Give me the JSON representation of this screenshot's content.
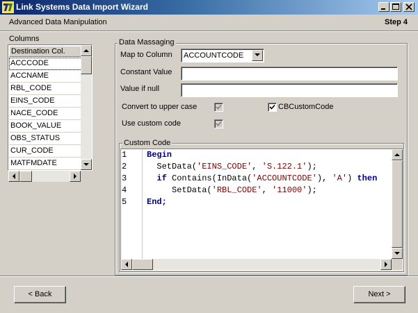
{
  "window": {
    "title": "Link Systems Data Import Wizard",
    "icon": "app-logo-icon",
    "buttons": [
      "minimize-icon",
      "maximize-icon",
      "close-icon"
    ]
  },
  "header": {
    "subtitle": "Advanced Data Manipulation",
    "step": "Step 4"
  },
  "columns": {
    "label": "Columns",
    "header": "Destination Col.",
    "items": [
      "ACCCODE",
      "ACCNAME",
      "RBL_CODE",
      "EINS_CODE",
      "NACE_CODE",
      "BOOK_VALUE",
      "OBS_STATUS",
      "CUR_CODE",
      "MATFMDATE"
    ],
    "selected_index": 0
  },
  "massaging": {
    "group_label": "Data Massaging",
    "map_to_column_label": "Map to Column",
    "map_to_column_value": "ACCOUNTCODE",
    "constant_value_label": "Constant Value",
    "constant_value": "",
    "value_if_null_label": "Value if null",
    "value_if_null": "",
    "upper_case_label": "Convert to upper case",
    "upper_case_checked": true,
    "cb_custom_code_label": "CBCustomCode",
    "cb_custom_code_checked": true,
    "use_custom_code_label": "Use custom code",
    "use_custom_code_checked": true
  },
  "custom_code": {
    "group_label": "Custom Code",
    "line_numbers": [
      "1",
      "2",
      "3",
      "4",
      "5"
    ],
    "lines": [
      [
        {
          "t": "Begin",
          "c": "kw"
        }
      ],
      [
        {
          "t": "  SetData(",
          "c": ""
        },
        {
          "t": "'EINS_CODE'",
          "c": "str"
        },
        {
          "t": ", ",
          "c": ""
        },
        {
          "t": "'S.122.1'",
          "c": "str"
        },
        {
          "t": ");",
          "c": ""
        }
      ],
      [
        {
          "t": "  ",
          "c": ""
        },
        {
          "t": "if",
          "c": "kw"
        },
        {
          "t": " Contains(InData(",
          "c": ""
        },
        {
          "t": "'ACCOUNTCODE'",
          "c": "str"
        },
        {
          "t": "), ",
          "c": ""
        },
        {
          "t": "'A'",
          "c": "str"
        },
        {
          "t": ") ",
          "c": ""
        },
        {
          "t": "then",
          "c": "kw"
        }
      ],
      [
        {
          "t": "     SetData(",
          "c": ""
        },
        {
          "t": "'RBL_CODE'",
          "c": "str"
        },
        {
          "t": ", ",
          "c": ""
        },
        {
          "t": "'11000'",
          "c": "str"
        },
        {
          "t": ");",
          "c": ""
        }
      ],
      [
        {
          "t": "End;",
          "c": "kw"
        }
      ]
    ]
  },
  "footer": {
    "back_label": "< Back",
    "next_label": "Next >"
  }
}
